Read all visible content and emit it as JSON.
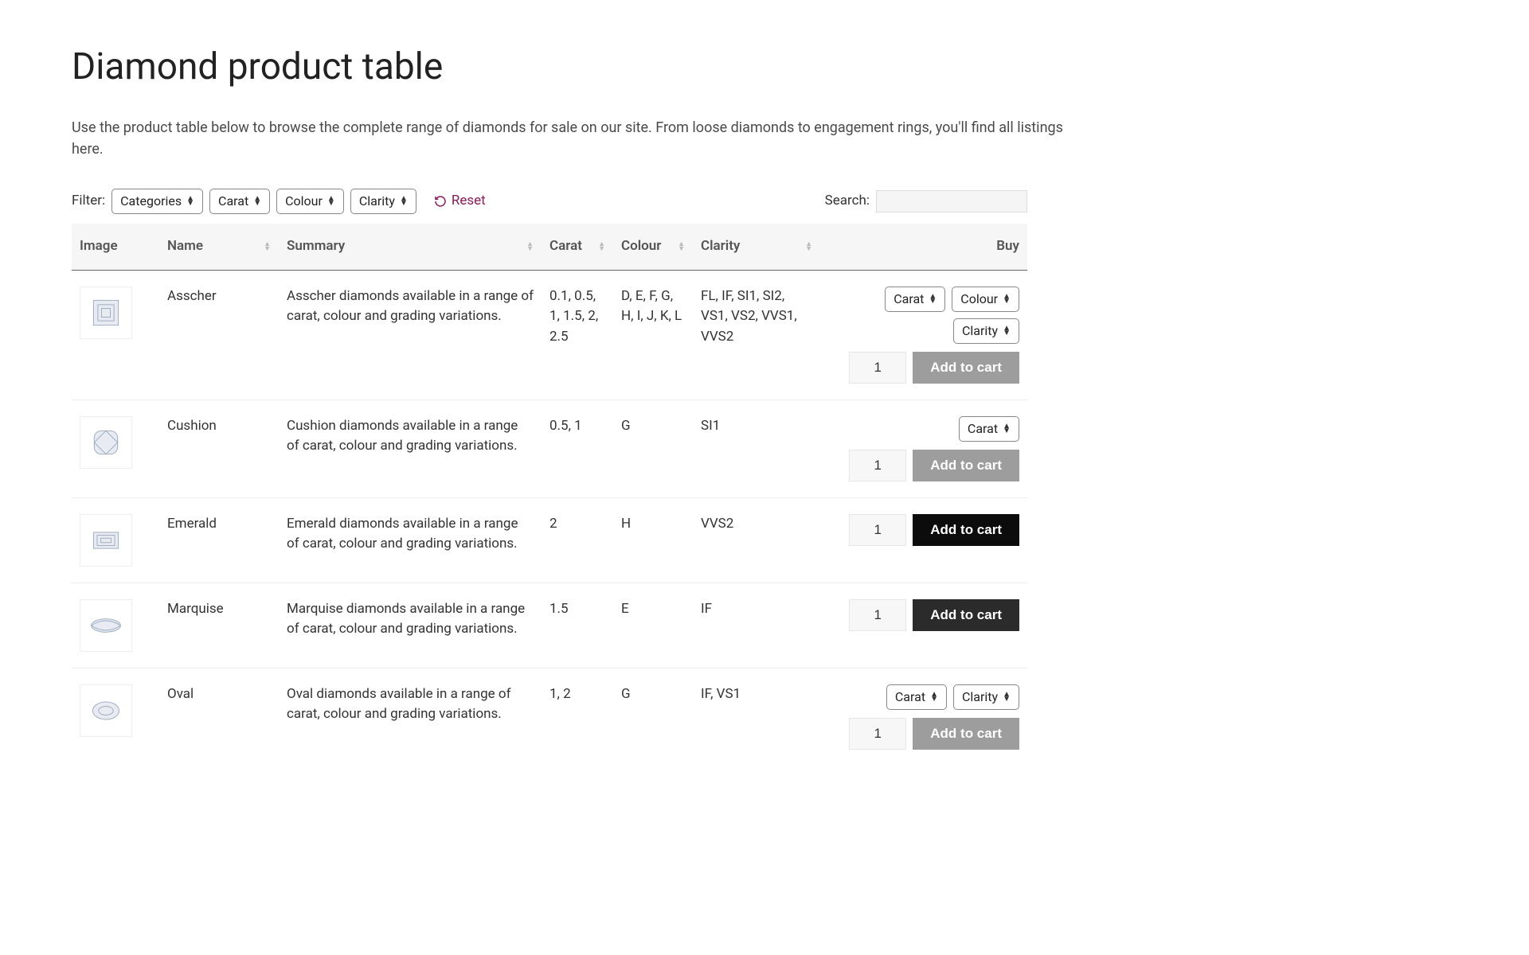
{
  "page": {
    "title": "Diamond product table",
    "intro": "Use the product table below to browse the complete range of diamonds for sale on our site. From loose diamonds to engagement rings, you'll find all listings here."
  },
  "filter": {
    "label": "Filter:",
    "categories": "Categories",
    "carat": "Carat",
    "colour": "Colour",
    "clarity": "Clarity",
    "reset": "Reset"
  },
  "search": {
    "label": "Search:"
  },
  "columns": {
    "image": "Image",
    "name": "Name",
    "summary": "Summary",
    "carat": "Carat",
    "colour": "Colour",
    "clarity": "Clarity",
    "buy": "Buy"
  },
  "buy": {
    "qty_default": "1",
    "add_label": "Add to cart",
    "carat": "Carat",
    "colour": "Colour",
    "clarity": "Clarity"
  },
  "rows": [
    {
      "name": "Asscher",
      "summary": "Asscher diamonds available in a range of carat, colour and grading variations.",
      "carat": "0.1, 0.5, 1, 1.5, 2, 2.5",
      "colour": "D, E, F, G, H, I, J, K, L",
      "clarity": "FL, IF, SI1, SI2, VS1, VS2, VVS1, VVS2",
      "selects": [
        "carat",
        "colour",
        "clarity"
      ],
      "btn_variant": "grey",
      "shape": "asscher"
    },
    {
      "name": "Cushion",
      "summary": "Cushion diamonds available in a range of carat, colour and grading variations.",
      "carat": "0.5, 1",
      "colour": "G",
      "clarity": "SI1",
      "selects": [
        "carat"
      ],
      "btn_variant": "grey",
      "shape": "cushion"
    },
    {
      "name": "Emerald",
      "summary": "Emerald diamonds available in a range of carat, colour and grading variations.",
      "carat": "2",
      "colour": "H",
      "clarity": "VVS2",
      "selects": [],
      "btn_variant": "black",
      "shape": "emerald"
    },
    {
      "name": "Marquise",
      "summary": "Marquise diamonds available in a range of carat, colour and grading variations.",
      "carat": "1.5",
      "colour": "E",
      "clarity": "IF",
      "selects": [],
      "btn_variant": "dark",
      "shape": "marquise"
    },
    {
      "name": "Oval",
      "summary": "Oval diamonds available in a range of carat, colour and grading variations.",
      "carat": "1, 2",
      "colour": "G",
      "clarity": "IF, VS1",
      "selects": [
        "carat",
        "clarity"
      ],
      "btn_variant": "grey",
      "shape": "oval"
    }
  ]
}
